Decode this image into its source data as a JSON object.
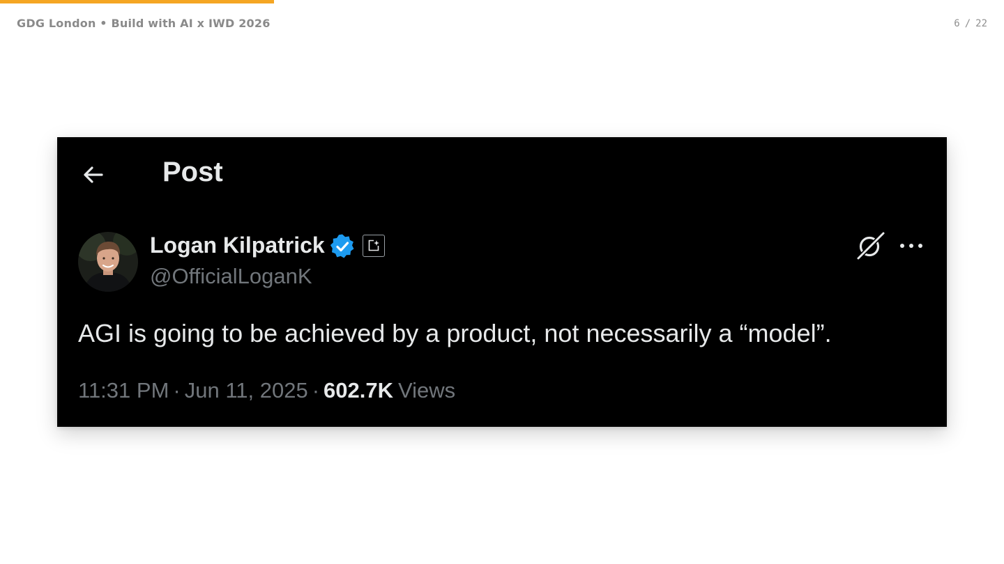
{
  "slide": {
    "header_title": "GDG London • Build with AI x IWD 2026",
    "page_current": "6",
    "page_separator": "/",
    "page_total": "22",
    "progress_fraction": 0.2727,
    "accent_color": "#f5a623"
  },
  "post": {
    "back_icon": "arrow-left-icon",
    "title": "Post",
    "author": {
      "name": "Logan Kilpatrick",
      "handle": "@OfficialLoganK",
      "verified_icon": "verified-badge-icon",
      "affiliate_icon": "affiliate-badge-icon",
      "verified_color": "#1d9bf0"
    },
    "grok_icon": "grok-icon",
    "more_icon": "more-options-icon",
    "text": "AGI is going to be achieved by a product, not necessarily a “model”.",
    "time": "11:31 PM",
    "date": "Jun 11, 2025",
    "meta_separator": "·",
    "views_count": "602.7K",
    "views_label": "Views"
  }
}
